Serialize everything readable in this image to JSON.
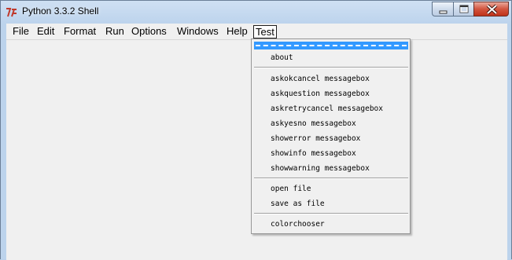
{
  "window": {
    "title": "Python 3.3.2 Shell"
  },
  "menubar": {
    "items": [
      "File",
      "Edit",
      "Format",
      "Run",
      "Options",
      "Windows",
      "Help",
      "Test"
    ]
  },
  "dropdown": {
    "items": [
      "about",
      "askokcancel messagebox",
      "askquestion messagebox",
      "askretrycancel messagebox",
      "askyesno messagebox",
      "showerror messagebox",
      "showinfo messagebox",
      "showwarning messagebox",
      "open file",
      "save as file",
      "colorchooser"
    ]
  }
}
